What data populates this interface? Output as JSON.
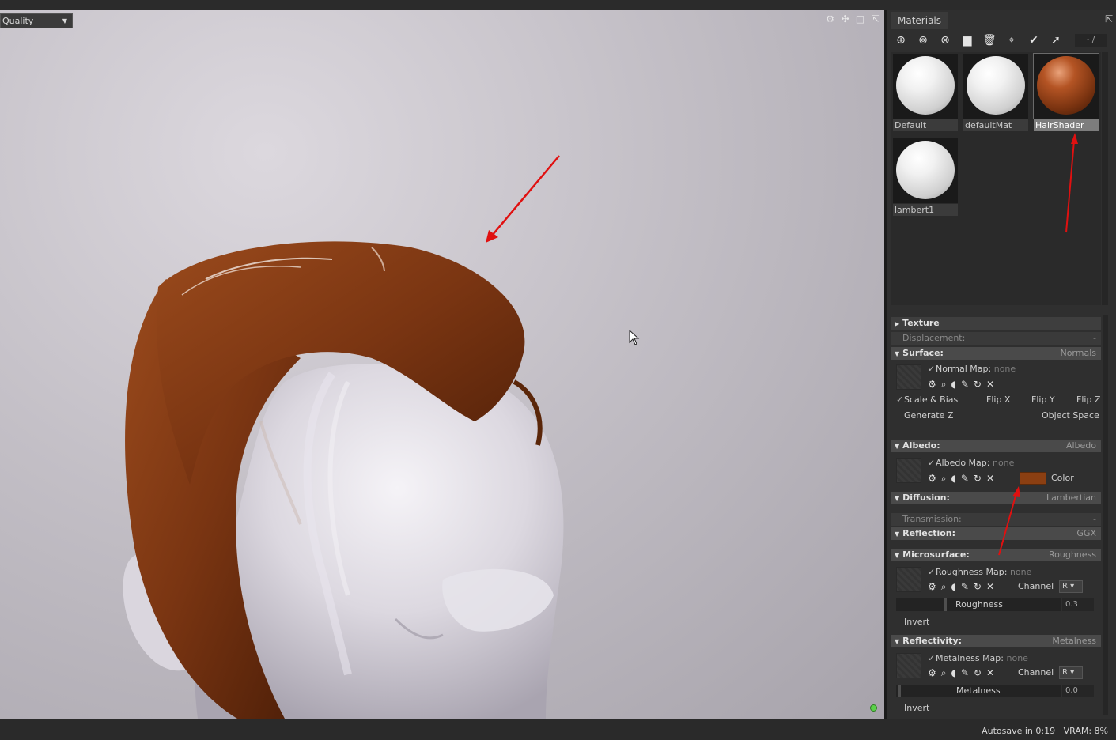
{
  "viewport": {
    "quality_label": "Quality",
    "tool_icons": [
      "gear-icon",
      "move-icon",
      "maximize-icon",
      "popout-icon"
    ]
  },
  "panel": {
    "tab": "Materials",
    "pager": "- /",
    "toolbar_icons": [
      "add-icon",
      "duplicate-icon",
      "merge-icon",
      "folder-icon",
      "delete-icon",
      "picker-icon",
      "check-icon",
      "export-icon"
    ],
    "materials": [
      {
        "name": "Default",
        "color": "white"
      },
      {
        "name": "defaultMat",
        "color": "white"
      },
      {
        "name": "HairShader",
        "color": "brown",
        "selected": true
      },
      {
        "name": "lambert1",
        "color": "white"
      }
    ]
  },
  "props": {
    "texture": "Texture",
    "displacement": "Displacement:",
    "displacement_val": "-",
    "surface": "Surface:",
    "surface_val": "Normals",
    "normal_map": "Normal Map:",
    "normal_map_val": "none",
    "scale_bias": "Scale & Bias",
    "flip_x": "Flip X",
    "flip_y": "Flip Y",
    "flip_z": "Flip Z",
    "generate_z": "Generate Z",
    "object_space": "Object Space",
    "albedo": "Albedo:",
    "albedo_val": "Albedo",
    "albedo_map": "Albedo Map:",
    "albedo_map_val": "none",
    "color_label": "Color",
    "albedo_color": "#8b3f12",
    "diffusion": "Diffusion:",
    "diffusion_val": "Lambertian",
    "transmission": "Transmission:",
    "transmission_val": "-",
    "reflection": "Reflection:",
    "reflection_val": "GGX",
    "microsurface": "Microsurface:",
    "microsurface_val": "Roughness",
    "roughness_map": "Roughness Map:",
    "roughness_map_val": "none",
    "channel": "Channel",
    "roughness_channel": "R",
    "roughness_label": "Roughness",
    "roughness_value": "0.3",
    "invert": "Invert",
    "reflectivity": "Reflectivity:",
    "reflectivity_val": "Metalness",
    "metalness_map": "Metalness Map:",
    "metalness_map_val": "none",
    "metalness_channel": "R",
    "metalness_label": "Metalness",
    "metalness_value": "0.0",
    "invert2": "Invert"
  },
  "status": {
    "autosave": "Autosave in 0:19",
    "vram": "VRAM: 8%"
  },
  "colors": {
    "hair": "#7a3512",
    "annotation_arrow": "#e01010",
    "status_dot": "#5bd14a"
  }
}
